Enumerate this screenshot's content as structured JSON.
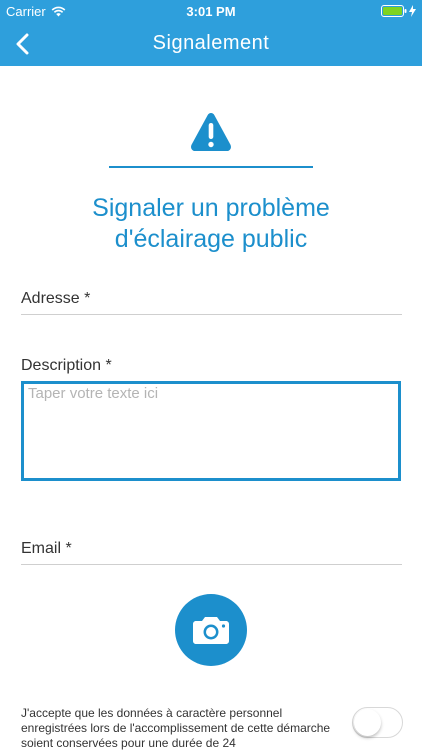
{
  "status_bar": {
    "carrier": "Carrier",
    "time": "3:01 PM",
    "icons": [
      "wifi-icon",
      "battery-icon",
      "charging-icon"
    ]
  },
  "nav_bar": {
    "title": "Signalement",
    "back_icon": "chevron-left-icon"
  },
  "header": {
    "icon": "warning-icon",
    "title_line1": "Signaler un problème",
    "title_line2": "d'éclairage public"
  },
  "form": {
    "adresse_label": "Adresse *",
    "description_label": "Description *",
    "description_placeholder": "Taper votre texte ici",
    "email_label": "Email *",
    "photo_icon": "camera-icon"
  },
  "consent": {
    "text": "J'accepte que les données à caractère personnel enregistrées lors de l'accomplissement de cette démarche soient conservées pour une durée de 24",
    "toggle_on": false
  },
  "colors": {
    "primary": "#2e9fdc",
    "accent": "#1c8fcc"
  }
}
